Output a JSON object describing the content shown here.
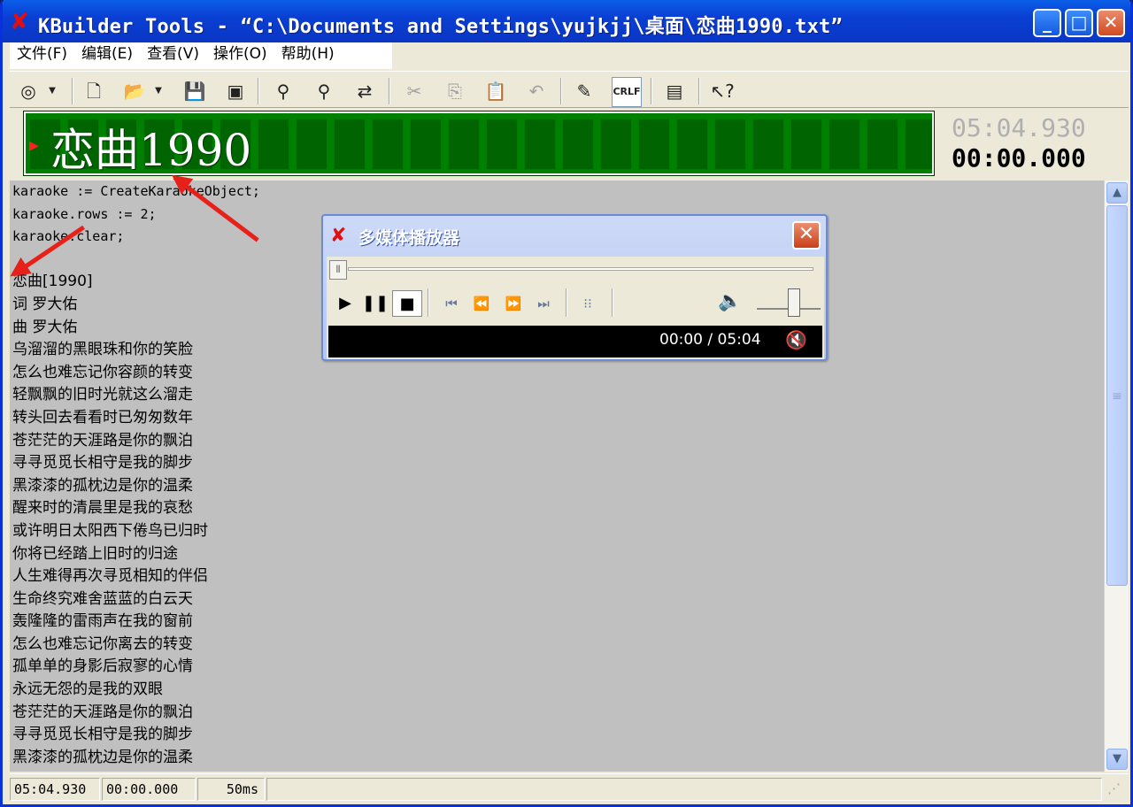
{
  "window": {
    "title": "KBuilder Tools - “C:\\Documents and Settings\\yujkjj\\桌面\\恋曲1990.txt”",
    "buttons": {
      "minimize": "_",
      "maximize": "□",
      "close": "✕"
    }
  },
  "menu": [
    "文件(F)",
    "编辑(E)",
    "查看(V)",
    "操作(O)",
    "帮助(H)"
  ],
  "toolbar": {
    "icons": [
      "globe-icon",
      "dropdown-arrow-icon",
      "new-file-icon",
      "open-folder-icon",
      "dropdown-arrow-icon",
      "save-icon",
      "save-all-icon",
      "find-icon",
      "find-next-icon",
      "replace-icon",
      "cut-icon",
      "copy-icon",
      "paste-icon",
      "undo-icon",
      "highlight-icon",
      "crlf-icon",
      "preview-icon",
      "help-icon"
    ]
  },
  "lyric_display": {
    "text": "恋曲1990",
    "total_time": "05:04.930",
    "current_time": "00:00.000"
  },
  "editor": {
    "lines": [
      "karaoke := CreateKaraokeObject;",
      "karaoke.rows := 2;",
      "karaoke.clear;",
      "",
      "恋曲[1990]",
      "词 罗大佑",
      "曲 罗大佑",
      "乌溜溜的黑眼珠和你的笑脸",
      "怎么也难忘记你容颜的转变",
      "轻飘飘的旧时光就这么溜走",
      "转头回去看看时已匆匆数年",
      "苍茫茫的天涯路是你的飘泊",
      "寻寻觅觅长相守是我的脚步",
      "黑漆漆的孤枕边是你的温柔",
      "醒来时的清晨里是我的哀愁",
      "或许明日太阳西下倦鸟已归时",
      "你将已经踏上旧时的归途",
      "人生难得再次寻觅相知的伴侣",
      "生命终究难舍蓝蓝的白云天",
      "轰隆隆的雷雨声在我的窗前",
      "怎么也难忘记你离去的转变",
      "孤单单的身影后寂寥的心情",
      "永远无怨的是我的双眼",
      "苍茫茫的天涯路是你的飘泊",
      "寻寻觅觅长相守是我的脚步",
      "黑漆漆的孤枕边是你的温柔"
    ]
  },
  "status": {
    "total": "05:04.930",
    "current": "00:00.000",
    "interval": "50ms"
  },
  "player": {
    "title": "多媒体播放器",
    "time": "00:00 / 05:04",
    "position": 0,
    "volume": 0.55
  }
}
